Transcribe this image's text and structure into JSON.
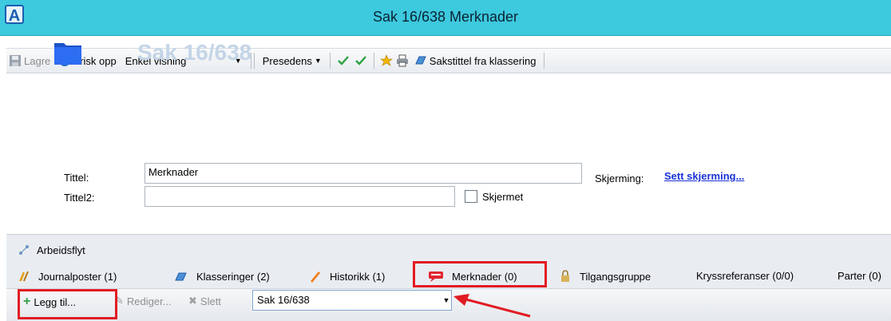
{
  "window": {
    "title": "Sak 16/638 Merknader",
    "app_icon_glyph": "A",
    "accent": "#3dc9de"
  },
  "toolbar": {
    "save_label": "Lagre",
    "refresh_label": "Frisk opp",
    "view_select": "Enkel visning",
    "precedence_label": "Presedens",
    "case_title_label": "Sakstittel fra klassering"
  },
  "case": {
    "heading": "Sak 16/638",
    "title_label": "Tittel:",
    "title_value": "Merknader",
    "title2_label": "Tittel2:",
    "title2_value": "",
    "screened_label": "Skjermet",
    "screening_label": "Skjerming:",
    "screening_link": "Sett skjerming..."
  },
  "workflow": {
    "label": "Arbeidsflyt"
  },
  "tabs": [
    {
      "label": "Journalposter (1)",
      "icon": "journal-icon"
    },
    {
      "label": "Klasseringer (2)",
      "icon": "classification-icon"
    },
    {
      "label": "Historikk (1)",
      "icon": "history-icon"
    },
    {
      "label": "Merknader (0)",
      "icon": "comment-icon",
      "selected": true
    },
    {
      "label": "Tilgangsgruppe",
      "icon": "access-group-icon"
    },
    {
      "label": "Kryssreferanser (0/0)",
      "icon": ""
    },
    {
      "label": "Parter (0)",
      "icon": ""
    }
  ],
  "subtoolbar": {
    "add_label": "Legg til...",
    "edit_label": "Rediger...",
    "delete_label": "Slett",
    "case_select": "Sak 16/638"
  },
  "highlight_color": "#e21b23"
}
